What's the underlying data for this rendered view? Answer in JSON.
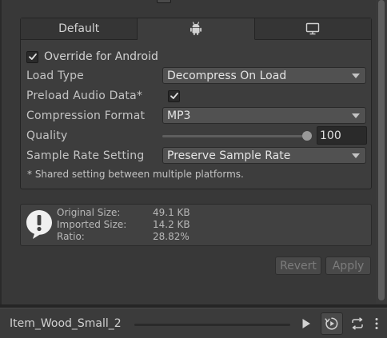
{
  "tabs": [
    {
      "label": "Default",
      "active": false
    },
    {
      "icon": "android-icon",
      "active": true
    },
    {
      "icon": "monitor-icon",
      "active": false
    }
  ],
  "override": {
    "label": "Override for Android",
    "checked": true
  },
  "settings": {
    "load_type": {
      "label": "Load Type",
      "value": "Decompress On Load"
    },
    "preload": {
      "label": "Preload Audio Data*",
      "checked": true
    },
    "compression": {
      "label": "Compression Format",
      "value": "MP3"
    },
    "quality": {
      "label": "Quality",
      "value": "100",
      "level": 1.0
    },
    "sample_rate": {
      "label": "Sample Rate Setting",
      "value": "Preserve Sample Rate"
    }
  },
  "note": "* Shared setting between multiple platforms.",
  "info": {
    "icon": "info-icon",
    "rows": [
      {
        "label": "Original Size:",
        "value": "49.1 KB"
      },
      {
        "label": "Imported Size:",
        "value": "14.2 KB"
      },
      {
        "label": "Ratio:",
        "value": "28.82%"
      }
    ]
  },
  "buttons": {
    "revert": "Revert",
    "apply": "Apply"
  },
  "preview": {
    "clip_name": "Item_Wood_Small_2",
    "controls": [
      {
        "icon": "play-icon"
      },
      {
        "icon": "auto-play-icon",
        "active": true
      },
      {
        "icon": "loop-icon"
      },
      {
        "icon": "more-vertical-icon"
      }
    ]
  },
  "colors": {
    "background": "#383838",
    "panel": "#3d3d3d",
    "field": "#515151",
    "text": "#c4c4c4"
  }
}
